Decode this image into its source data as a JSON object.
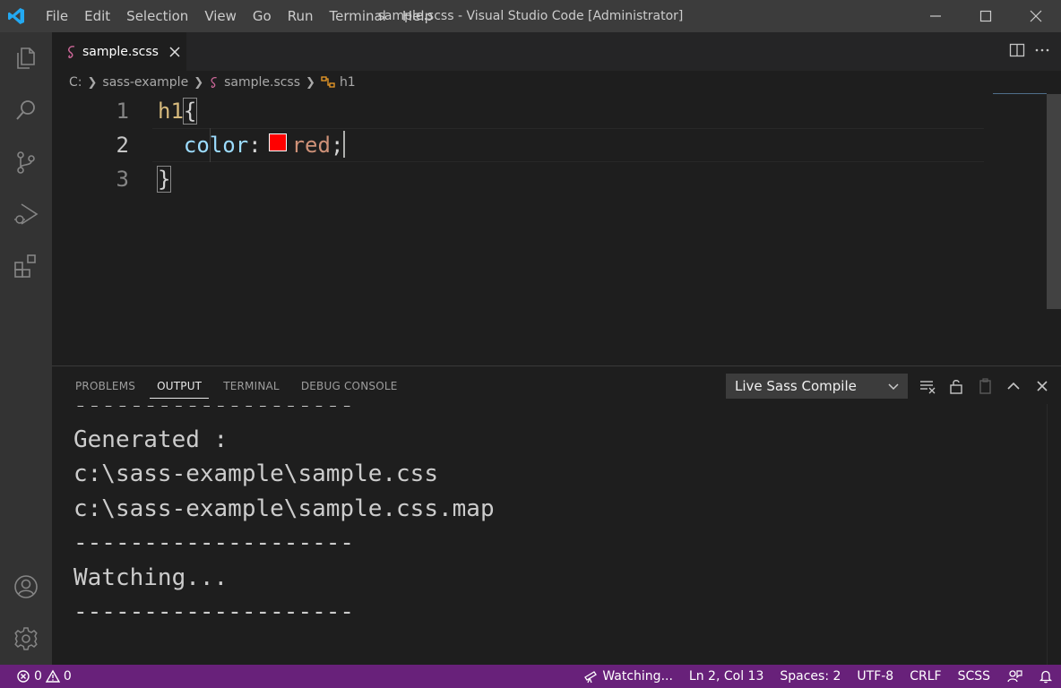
{
  "window": {
    "title": "sample.scss - Visual Studio Code [Administrator]",
    "menu": [
      "File",
      "Edit",
      "Selection",
      "View",
      "Go",
      "Run",
      "Terminal",
      "Help"
    ]
  },
  "tabs": [
    {
      "label": "sample.scss",
      "active": true
    }
  ],
  "breadcrumb": [
    "C:",
    "sass-example",
    "sample.scss",
    "h1"
  ],
  "editor": {
    "lines": [
      {
        "number": "1",
        "selector": "h1",
        "brace": "{"
      },
      {
        "number": "2",
        "property": "color",
        "colon": ":",
        "value": "red",
        "semicolon": ";",
        "swatch_color": "#ff0000"
      },
      {
        "number": "3",
        "brace": "}"
      }
    ]
  },
  "panel": {
    "tabs": [
      "PROBLEMS",
      "OUTPUT",
      "TERMINAL",
      "DEBUG CONSOLE"
    ],
    "active_tab": "OUTPUT",
    "output_channel": "Live Sass Compile",
    "output_lines": [
      "--------------------",
      "Generated :",
      "c:\\sass-example\\sample.css",
      "c:\\sass-example\\sample.css.map",
      "--------------------",
      "Watching...",
      "--------------------"
    ]
  },
  "statusbar": {
    "errors": "0",
    "warnings": "0",
    "watching": "Watching...",
    "position": "Ln 2, Col 13",
    "spaces": "Spaces: 2",
    "encoding": "UTF-8",
    "eol": "CRLF",
    "language": "SCSS",
    "color": "#68217a"
  },
  "icons": {
    "activity": [
      "explorer-icon",
      "search-icon",
      "source-control-icon",
      "run-debug-icon",
      "extensions-icon",
      "account-icon",
      "settings-gear-icon"
    ]
  }
}
